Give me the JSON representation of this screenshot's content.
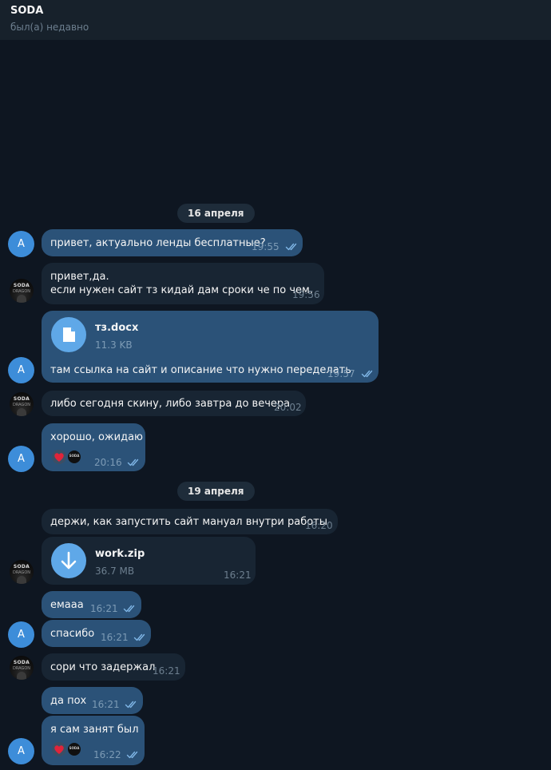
{
  "header": {
    "name": "SODA",
    "status": "был(а) недавно"
  },
  "dates": {
    "d1": "16 апреля",
    "d2": "19 апреля"
  },
  "avatars": {
    "mine_letter": "A",
    "soda_line1": "SODA",
    "soda_line2": "DRAGON"
  },
  "colors": {
    "outgoing_bubble": "#2b5278",
    "incoming_bubble": "#182533",
    "background": "#0e1621",
    "accent": "#5fa8e8"
  },
  "messages": [
    {
      "text": "привет, актуально ленды бесплатные?",
      "time": "19:55"
    },
    {
      "text": "привет,да.",
      "text2": "если нужен сайт тз кидай дам сроки че по чем.",
      "time": "19:56"
    },
    {
      "file_name": "тз.docx",
      "file_size": "11.3 KB",
      "text": "там ссылка на сайт и описание что нужно переделать",
      "time": "19:57"
    },
    {
      "text": "либо сегодня скину, либо завтра до вечера",
      "time": "20:02"
    },
    {
      "text": "хорошо, ожидаю",
      "time": "20:16",
      "reactions": [
        "heart-reaction",
        "soda-avatar"
      ]
    },
    {
      "text": "держи, как запустить сайт мануал внутри работы",
      "time": "16:20"
    },
    {
      "file_name": "work.zip",
      "file_size": "36.7 MB",
      "time": "16:21"
    },
    {
      "text": "емааа",
      "time": "16:21"
    },
    {
      "text": "спасибо",
      "time": "16:21"
    },
    {
      "text": "сори что задержал",
      "time": "16:21"
    },
    {
      "text": "да пох",
      "time": "16:21"
    },
    {
      "text": "я сам занят был",
      "time": "16:22",
      "reactions": [
        "heart-reaction",
        "soda-avatar"
      ]
    }
  ]
}
